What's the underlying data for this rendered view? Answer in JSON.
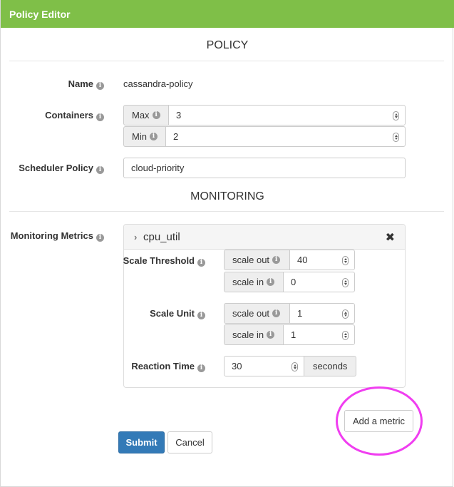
{
  "header": {
    "title": "Policy Editor"
  },
  "policy_section": {
    "title": "POLICY"
  },
  "name": {
    "label": "Name",
    "value": "cassandra-policy"
  },
  "containers": {
    "label": "Containers",
    "max_label": "Max",
    "max_value": "3",
    "min_label": "Min",
    "min_value": "2"
  },
  "scheduler": {
    "label": "Scheduler Policy",
    "value": "cloud-priority"
  },
  "monitoring_section": {
    "title": "MONITORING"
  },
  "metrics": {
    "label": "Monitoring Metrics",
    "name": "cpu_util",
    "chevron": "›",
    "close": "✖",
    "scale_threshold": {
      "label": "Scale Threshold",
      "out_label": "scale out",
      "out_value": "40",
      "in_label": "scale in",
      "in_value": "0"
    },
    "scale_unit": {
      "label": "Scale Unit",
      "out_label": "scale out",
      "out_value": "1",
      "in_label": "scale in",
      "in_value": "1"
    },
    "reaction_time": {
      "label": "Reaction Time",
      "value": "30",
      "unit": "seconds"
    }
  },
  "buttons": {
    "add_metric": "Add a metric",
    "submit": "Submit",
    "cancel": "Cancel"
  },
  "icons": {
    "info": "i"
  },
  "colors": {
    "header_bg": "#7fbf48",
    "primary": "#337ab7",
    "highlight": "#f03ef0"
  }
}
